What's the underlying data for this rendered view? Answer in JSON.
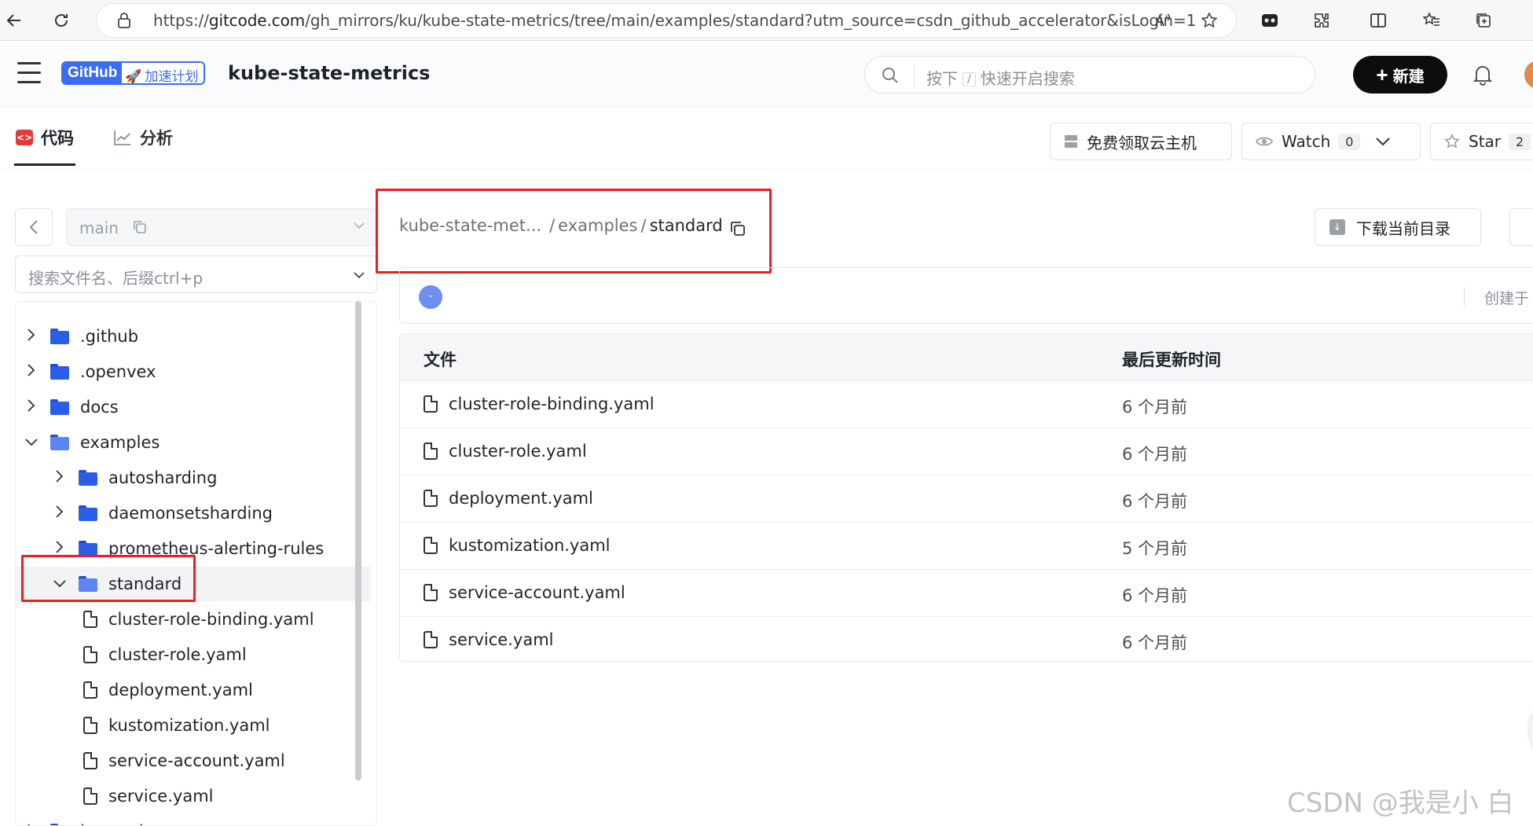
{
  "browser": {
    "url_prefix": "https://",
    "url_host": "gitcode.com",
    "url_path": "/gh_mirrors/ku/kube-state-metrics/tree/main/examples/standard?utm_source=csdn_github_accelerator&isLogin=1"
  },
  "header": {
    "badge_github": "GitHub",
    "badge_plan": "加速计划",
    "repo_name": "kube-state-metrics",
    "search_placeholder_a": "按下",
    "search_placeholder_key": "/",
    "search_placeholder_b": "快速开启搜索",
    "new_button": "新建"
  },
  "tabs": {
    "code": "代码",
    "analysis": "分析",
    "free_cloud": "免费领取云主机",
    "watch": "Watch",
    "watch_count": "0",
    "star": "Star",
    "star_count": "2"
  },
  "sidebar": {
    "branch": "main",
    "file_search_placeholder": "搜索文件名、后缀ctrl+p",
    "tree": [
      {
        "label": ".github",
        "kind": "folder",
        "depth": 0,
        "expanded": false
      },
      {
        "label": ".openvex",
        "kind": "folder",
        "depth": 0,
        "expanded": false
      },
      {
        "label": "docs",
        "kind": "folder",
        "depth": 0,
        "expanded": false
      },
      {
        "label": "examples",
        "kind": "folder",
        "depth": 0,
        "expanded": true
      },
      {
        "label": "autosharding",
        "kind": "folder",
        "depth": 1,
        "expanded": false
      },
      {
        "label": "daemonsetsharding",
        "kind": "folder",
        "depth": 1,
        "expanded": false
      },
      {
        "label": "prometheus-alerting-rules",
        "kind": "folder",
        "depth": 1,
        "expanded": false
      },
      {
        "label": "standard",
        "kind": "folder",
        "depth": 1,
        "expanded": true,
        "selected": true
      },
      {
        "label": "cluster-role-binding.yaml",
        "kind": "file",
        "depth": 2
      },
      {
        "label": "cluster-role.yaml",
        "kind": "file",
        "depth": 2
      },
      {
        "label": "deployment.yaml",
        "kind": "file",
        "depth": 2
      },
      {
        "label": "kustomization.yaml",
        "kind": "file",
        "depth": 2
      },
      {
        "label": "service-account.yaml",
        "kind": "file",
        "depth": 2
      },
      {
        "label": "service.yaml",
        "kind": "file",
        "depth": 2
      },
      {
        "label": "internal",
        "kind": "folder",
        "depth": 0,
        "expanded": false
      }
    ]
  },
  "main": {
    "breadcrumb": {
      "root": "kube-state-met...",
      "sep": "/",
      "mid": "examples",
      "current": "standard"
    },
    "download_button": "下载当前目录",
    "commit_dot": "-",
    "commit_created": "创建于",
    "table": {
      "col_file": "文件",
      "col_updated": "最后更新时间",
      "rows": [
        {
          "name": "cluster-role-binding.yaml",
          "updated": "6 个月前"
        },
        {
          "name": "cluster-role.yaml",
          "updated": "6 个月前"
        },
        {
          "name": "deployment.yaml",
          "updated": "6 个月前"
        },
        {
          "name": "kustomization.yaml",
          "updated": "5 个月前"
        },
        {
          "name": "service-account.yaml",
          "updated": "6 个月前"
        },
        {
          "name": "service.yaml",
          "updated": "6 个月前"
        }
      ]
    }
  },
  "watermark": "CSDN @我是小 白",
  "colors": {
    "highlight_red": "#ee1e1e",
    "brand_blue": "#3b6cf4",
    "folder_blue": "#2b5ee8"
  }
}
